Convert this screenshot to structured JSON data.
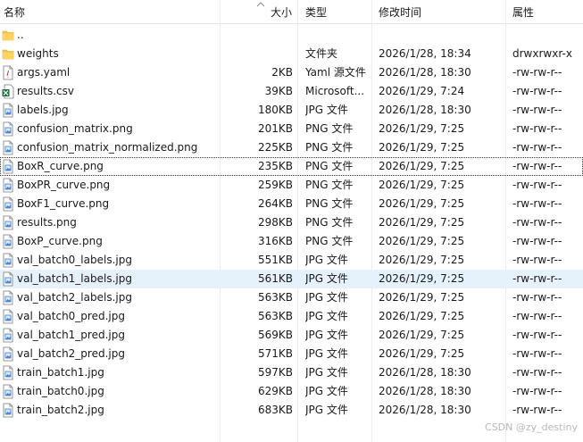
{
  "columns": {
    "name": "名称",
    "size": "大小",
    "type": "类型",
    "modified": "修改时间",
    "attributes": "属性"
  },
  "files": [
    {
      "name": "..",
      "size": "",
      "type": "",
      "modified": "",
      "attr": "",
      "icon": "folder-icon"
    },
    {
      "name": "weights",
      "size": "",
      "type": "文件夹",
      "modified": "2026/1/28, 18:34",
      "attr": "drwxrwxr-x",
      "icon": "folder-icon"
    },
    {
      "name": "args.yaml",
      "size": "2KB",
      "type": "Yaml 源文件",
      "modified": "2026/1/28, 18:30",
      "attr": "-rw-rw-r--",
      "icon": "yaml-file-icon"
    },
    {
      "name": "results.csv",
      "size": "39KB",
      "type": "Microsoft...",
      "modified": "2026/1/29, 7:24",
      "attr": "-rw-rw-r--",
      "icon": "excel-file-icon"
    },
    {
      "name": "labels.jpg",
      "size": "180KB",
      "type": "JPG 文件",
      "modified": "2026/1/28, 18:30",
      "attr": "-rw-rw-r--",
      "icon": "image-file-icon"
    },
    {
      "name": "confusion_matrix.png",
      "size": "201KB",
      "type": "PNG 文件",
      "modified": "2026/1/29, 7:25",
      "attr": "-rw-rw-r--",
      "icon": "image-file-icon"
    },
    {
      "name": "confusion_matrix_normalized.png",
      "size": "225KB",
      "type": "PNG 文件",
      "modified": "2026/1/29, 7:25",
      "attr": "-rw-rw-r--",
      "icon": "image-file-icon"
    },
    {
      "name": "BoxR_curve.png",
      "size": "235KB",
      "type": "PNG 文件",
      "modified": "2026/1/29, 7:25",
      "attr": "-rw-rw-r--",
      "icon": "image-file-icon"
    },
    {
      "name": "BoxPR_curve.png",
      "size": "259KB",
      "type": "PNG 文件",
      "modified": "2026/1/29, 7:25",
      "attr": "-rw-rw-r--",
      "icon": "image-file-icon"
    },
    {
      "name": "BoxF1_curve.png",
      "size": "264KB",
      "type": "PNG 文件",
      "modified": "2026/1/29, 7:25",
      "attr": "-rw-rw-r--",
      "icon": "image-file-icon"
    },
    {
      "name": "results.png",
      "size": "298KB",
      "type": "PNG 文件",
      "modified": "2026/1/29, 7:25",
      "attr": "-rw-rw-r--",
      "icon": "image-file-icon"
    },
    {
      "name": "BoxP_curve.png",
      "size": "316KB",
      "type": "PNG 文件",
      "modified": "2026/1/29, 7:25",
      "attr": "-rw-rw-r--",
      "icon": "image-file-icon"
    },
    {
      "name": "val_batch0_labels.jpg",
      "size": "551KB",
      "type": "JPG 文件",
      "modified": "2026/1/29, 7:25",
      "attr": "-rw-rw-r--",
      "icon": "image-file-icon"
    },
    {
      "name": "val_batch1_labels.jpg",
      "size": "561KB",
      "type": "JPG 文件",
      "modified": "2026/1/29, 7:25",
      "attr": "-rw-rw-r--",
      "icon": "image-file-icon"
    },
    {
      "name": "val_batch2_labels.jpg",
      "size": "563KB",
      "type": "JPG 文件",
      "modified": "2026/1/29, 7:25",
      "attr": "-rw-rw-r--",
      "icon": "image-file-icon"
    },
    {
      "name": "val_batch0_pred.jpg",
      "size": "563KB",
      "type": "JPG 文件",
      "modified": "2026/1/29, 7:25",
      "attr": "-rw-rw-r--",
      "icon": "image-file-icon"
    },
    {
      "name": "val_batch1_pred.jpg",
      "size": "569KB",
      "type": "JPG 文件",
      "modified": "2026/1/29, 7:25",
      "attr": "-rw-rw-r--",
      "icon": "image-file-icon"
    },
    {
      "name": "val_batch2_pred.jpg",
      "size": "571KB",
      "type": "JPG 文件",
      "modified": "2026/1/29, 7:25",
      "attr": "-rw-rw-r--",
      "icon": "image-file-icon"
    },
    {
      "name": "train_batch1.jpg",
      "size": "597KB",
      "type": "JPG 文件",
      "modified": "2026/1/28, 18:30",
      "attr": "-rw-rw-r--",
      "icon": "image-file-icon"
    },
    {
      "name": "train_batch0.jpg",
      "size": "629KB",
      "type": "JPG 文件",
      "modified": "2026/1/28, 18:30",
      "attr": "-rw-rw-r--",
      "icon": "image-file-icon"
    },
    {
      "name": "train_batch2.jpg",
      "size": "683KB",
      "type": "JPG 文件",
      "modified": "2026/1/28, 18:30",
      "attr": "-rw-rw-r--",
      "icon": "image-file-icon"
    }
  ],
  "state": {
    "focused_file": "BoxR_curve.png",
    "selected_file": "val_batch1_labels.jpg",
    "sort_column": "大小",
    "sort_direction": "ascending"
  },
  "watermark": "CSDN @zy_destiny",
  "colors": {
    "selection": "#e5f1fb",
    "folder": "#f5c542",
    "excel": "#1e7145",
    "image_file": "#3a7bd5"
  }
}
